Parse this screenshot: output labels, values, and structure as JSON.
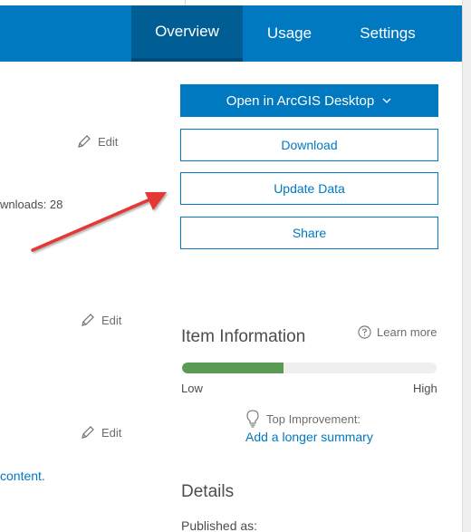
{
  "nav": {
    "tabs": [
      {
        "label": "Overview",
        "active": true
      },
      {
        "label": "Usage",
        "active": false
      },
      {
        "label": "Settings",
        "active": false
      }
    ]
  },
  "left_column": {
    "edit_label": "Edit",
    "downloads_text": "wnloads: 28",
    "content_link": "content."
  },
  "actions": {
    "open_desktop": "Open in ArcGIS Desktop",
    "download": "Download",
    "update_data": "Update Data",
    "share": "Share"
  },
  "item_information": {
    "title": "Item Information",
    "learn_more": "Learn more",
    "score_fraction": 0.4,
    "low_label": "Low",
    "high_label": "High",
    "top_improvement_label": "Top Improvement:",
    "top_improvement_link": "Add a longer summary"
  },
  "details": {
    "title": "Details",
    "published_as": "Published as:"
  },
  "colors": {
    "brand_blue": "#0079c1",
    "nav_active": "#005e95",
    "progress_green": "#5a9a55",
    "annotation_red": "#e53935"
  },
  "icons": {
    "edit": "pencil-icon",
    "dropdown": "chevron-down-icon",
    "learn_more": "question-circle-icon",
    "improvement": "lightbulb-icon"
  }
}
